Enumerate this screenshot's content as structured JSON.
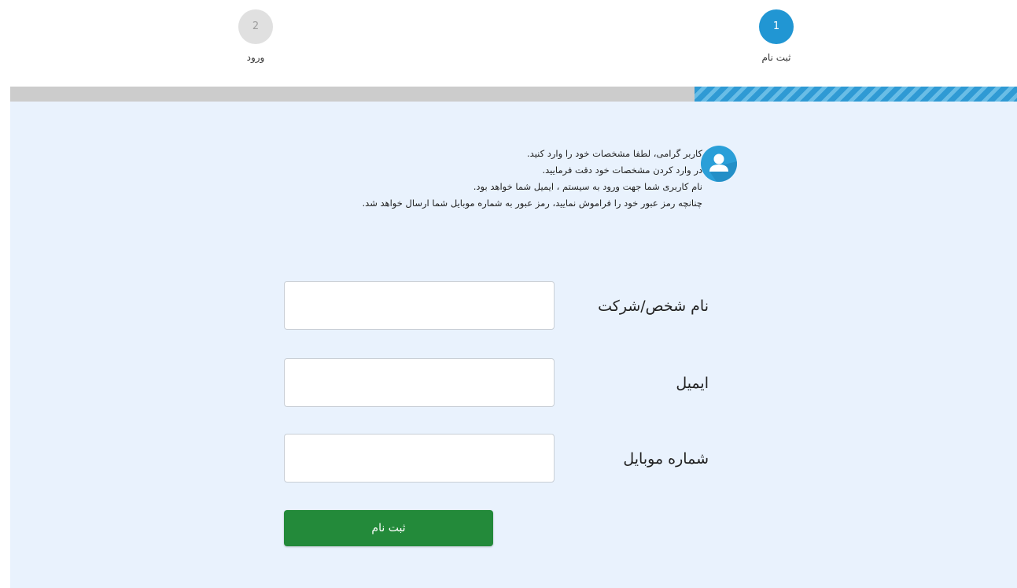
{
  "stepper": {
    "steps": [
      {
        "number": "1",
        "label": "ثبت نام",
        "state": "active"
      },
      {
        "number": "2",
        "label": "ورود",
        "state": "inactive"
      }
    ],
    "progress": 0.32,
    "colors": {
      "active": "#2196d3",
      "inactive": "#e0e0e0"
    }
  },
  "info": {
    "icon": "user-avatar-icon",
    "lines": [
      "کاربر گرامی، لطفا مشخصات خود را وارد کنید.",
      "در وارد کردن مشخصات خود دقت فرمایید.",
      "نام کاربری شما جهت ورود به سیستم ، ایمیل شما خواهد بود.",
      "چنانچه رمز عبور خود را فراموش نمایید، رمز عبور به شماره موبایل شما ارسال خواهد شد."
    ]
  },
  "form": {
    "fields": [
      {
        "label": "نام شخص/شرکت",
        "value": ""
      },
      {
        "label": "ایمیل",
        "value": ""
      },
      {
        "label": "شماره موبایل",
        "value": ""
      }
    ],
    "submit_label": "ثبت نام",
    "submit_color": "#238a3a"
  },
  "panel_background": "#e9f2fd"
}
